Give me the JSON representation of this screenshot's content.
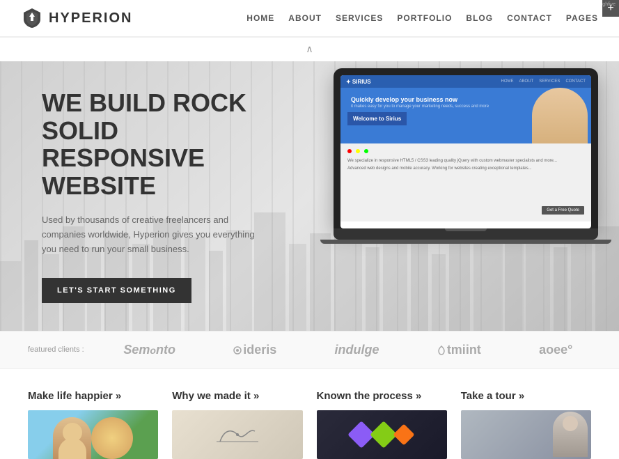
{
  "header": {
    "logo_text": "HYPERION",
    "nav_items": [
      "HOME",
      "ABOUT",
      "SERVICES",
      "PORTFOLIO",
      "BLOG",
      "CONTACT",
      "PAGES"
    ],
    "tab_btn": "+"
  },
  "hero": {
    "title": "WE BUILD ROCK SOLID RESPONSIVE WEBSITE",
    "subtitle": "Used by thousands of creative freelancers and companies worldwide, Hyperion gives you everything you need to run your small business.",
    "cta_btn": "LET'S START SOMETHING",
    "laptop_site_name": "SIRIUS",
    "laptop_headline": "Quickly develop your business now",
    "laptop_sub": "it makes easy for you to manage your marketing needs",
    "laptop_welcome": "Welcome to Sirius",
    "laptop_quote": "Get a Free Quote"
  },
  "clients": {
    "label": "featured clients :",
    "logos": [
      "Semonto",
      "ideris",
      "indulge",
      "tmiint",
      "aoee°"
    ]
  },
  "cards": [
    {
      "title": "Make life happier »",
      "type": "happy"
    },
    {
      "title": "Why we made it »",
      "type": "why"
    },
    {
      "title": "Known the process »",
      "type": "known"
    },
    {
      "title": "Take a tour »",
      "type": "tour"
    }
  ],
  "scroll_indicator": "∧"
}
